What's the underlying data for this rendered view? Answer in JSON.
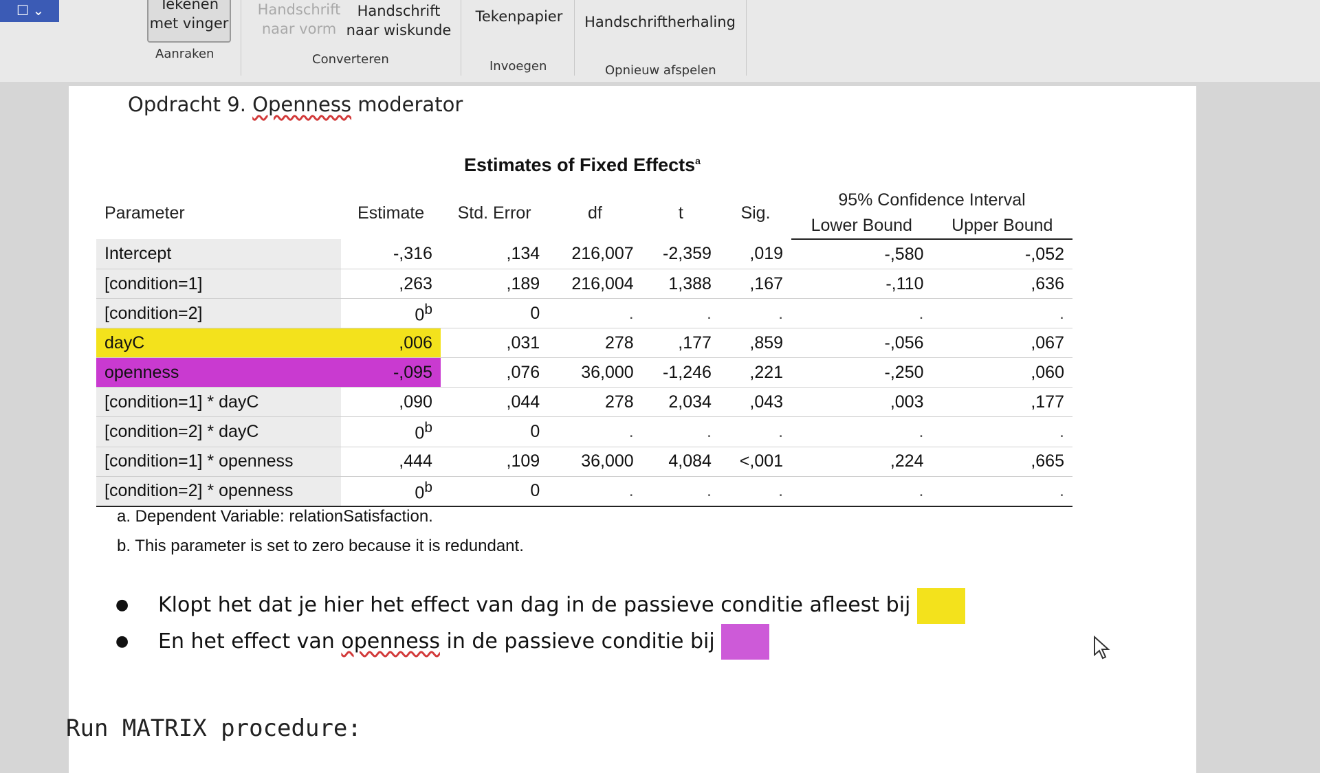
{
  "ribbon": {
    "quick_access": "☐ ⌄",
    "touch_button": "Tekenen met vinger",
    "touch_group": "Aanraken",
    "convert_shape": "Handschrift naar vorm",
    "convert_math": "Handschrift naar wiskunde",
    "convert_group": "Converteren",
    "insert_paper": "Tekenpapier",
    "insert_group": "Invoegen",
    "replay": "Handschriftherhaling",
    "replay_group": "Opnieuw afspelen"
  },
  "document": {
    "heading_prefix": "Opdracht 9.",
    "heading_word": "Openness",
    "heading_suffix": "moderator",
    "table_title": "Estimates of Fixed Effects",
    "table_title_sup": "a",
    "columns": {
      "parameter": "Parameter",
      "estimate": "Estimate",
      "std_error": "Std. Error",
      "df": "df",
      "t": "t",
      "sig": "Sig.",
      "ci": "95% Confidence Interval",
      "lower": "Lower Bound",
      "upper": "Upper Bound"
    },
    "rows": [
      {
        "param": "Intercept",
        "est": "-,316",
        "se": ",134",
        "df": "216,007",
        "t": "-2,359",
        "sig": ",019",
        "lo": "-,580",
        "hi": "-,052"
      },
      {
        "param": "[condition=1]",
        "est": ",263",
        "se": ",189",
        "df": "216,004",
        "t": "1,388",
        "sig": ",167",
        "lo": "-,110",
        "hi": ",636"
      },
      {
        "param": "[condition=2]",
        "est": "0",
        "est_sup": "b",
        "se": "0",
        "df": ".",
        "t": ".",
        "sig": ".",
        "lo": ".",
        "hi": "."
      },
      {
        "param": "dayC",
        "est": ",006",
        "se": ",031",
        "df": "278",
        "t": ",177",
        "sig": ",859",
        "lo": "-,056",
        "hi": ",067"
      },
      {
        "param": "openness",
        "est": "-,095",
        "se": ",076",
        "df": "36,000",
        "t": "-1,246",
        "sig": ",221",
        "lo": "-,250",
        "hi": ",060"
      },
      {
        "param": "[condition=1] * dayC",
        "est": ",090",
        "se": ",044",
        "df": "278",
        "t": "2,034",
        "sig": ",043",
        "lo": ",003",
        "hi": ",177"
      },
      {
        "param": "[condition=2] * dayC",
        "est": "0",
        "est_sup": "b",
        "se": "0",
        "df": ".",
        "t": ".",
        "sig": ".",
        "lo": ".",
        "hi": "."
      },
      {
        "param": "[condition=1] * openness",
        "est": ",444",
        "se": ",109",
        "df": "36,000",
        "t": "4,084",
        "sig": "<,001",
        "lo": ",224",
        "hi": ",665"
      },
      {
        "param": "[condition=2] * openness",
        "est": "0",
        "est_sup": "b",
        "se": "0",
        "df": ".",
        "t": ".",
        "sig": ".",
        "lo": ".",
        "hi": "."
      }
    ],
    "footnote_a": "a. Dependent Variable: relationSatisfaction.",
    "footnote_b": "b. This parameter is set to zero because it is redundant.",
    "question1_a": "Klopt het dat je hier het effect van dag in de passieve ",
    "question1_b": "conditie",
    "question1_c": " afleest bij ",
    "question2_a": "En het effect van ",
    "question2_b": "openness",
    "question2_c": " in de passieve conditie bij ",
    "matrix_text": "Run MATRIX procedure:"
  },
  "colors": {
    "highlight_yellow": "#f3e21c",
    "highlight_purple": "#c93ad0",
    "ribbon_bg": "#e9e9e9",
    "page_bg": "#ffffff"
  },
  "icons": [
    "pen-icon",
    "chevron-down-icon",
    "mouse-pointer-icon"
  ]
}
